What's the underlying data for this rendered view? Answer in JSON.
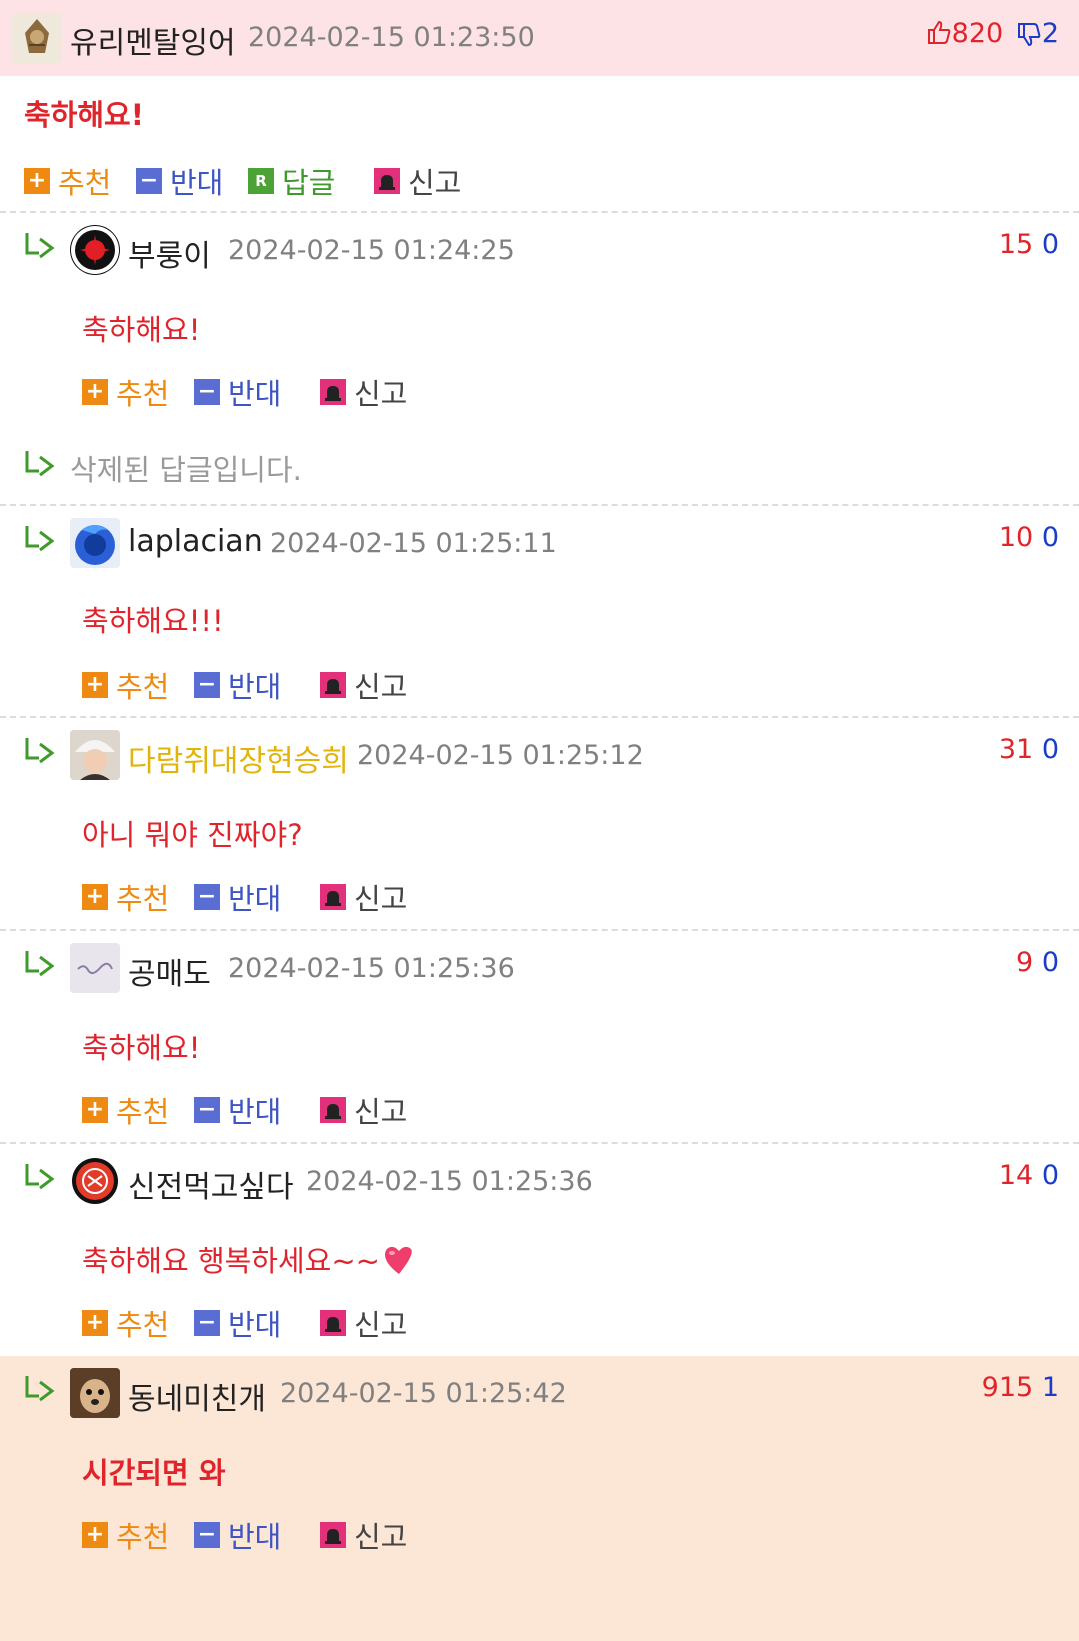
{
  "main_comment": {
    "nick": "유리멘탈잉어",
    "date": "2024-02-15 01:23:50",
    "up": "820",
    "down": "2",
    "text": "축하해요!",
    "actions": {
      "recommend": "추천",
      "oppose": "반대",
      "reply": "답글",
      "reply_badge": "R",
      "report": "신고"
    }
  },
  "action_labels": {
    "recommend": "추천",
    "oppose": "반대",
    "report": "신고"
  },
  "deleted_text": "삭제된 답글입니다.",
  "replies": [
    {
      "nick": "부룽이",
      "date": "2024-02-15 01:24:25",
      "up": "15",
      "down": "0",
      "text": "축하해요!"
    },
    {
      "nick": "laplacian",
      "date": "2024-02-15 01:25:11",
      "up": "10",
      "down": "0",
      "text": "축하해요!!!"
    },
    {
      "nick": "다람쥐대장현승희",
      "date": "2024-02-15 01:25:12",
      "up": "31",
      "down": "0",
      "text": "아니 뭐야 진짜야?"
    },
    {
      "nick": "공매도",
      "date": "2024-02-15 01:25:36",
      "up": "9",
      "down": "0",
      "text": "축하해요!"
    },
    {
      "nick": "신전먹고싶다",
      "date": "2024-02-15 01:25:36",
      "up": "14",
      "down": "0",
      "text": "축하해요 행복하세요~~"
    },
    {
      "nick": "동네미친개",
      "date": "2024-02-15 01:25:42",
      "up": "915",
      "down": "1",
      "text": "시간되면 와"
    }
  ],
  "colors": {
    "header_bg": "#fde3e5",
    "best_bg": "#fce6d5",
    "body_red": "#e0242c",
    "vote_down": "#1a3cc8",
    "gold_nick": "#e2b40a"
  }
}
